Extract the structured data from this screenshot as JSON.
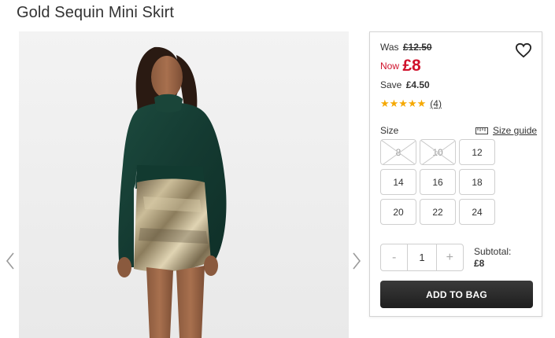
{
  "product": {
    "title": "Gold Sequin Mini Skirt"
  },
  "pricing": {
    "was_label": "Was",
    "was_price": "£12.50",
    "now_label": "Now",
    "now_price": "£8",
    "save_label": "Save",
    "save_amount": "£4.50",
    "now_color": "#d0112b"
  },
  "rating": {
    "stars": "★★★★★",
    "value": 5,
    "max": 5,
    "count": "(4)",
    "star_color": "#f5a800"
  },
  "size": {
    "label": "Size",
    "guide_label": "Size guide",
    "options": [
      {
        "label": "8",
        "available": false
      },
      {
        "label": "10",
        "available": false
      },
      {
        "label": "12",
        "available": true
      },
      {
        "label": "14",
        "available": true
      },
      {
        "label": "16",
        "available": true
      },
      {
        "label": "18",
        "available": true
      },
      {
        "label": "20",
        "available": true
      },
      {
        "label": "22",
        "available": true
      },
      {
        "label": "24",
        "available": true
      }
    ]
  },
  "quantity": {
    "minus": "-",
    "value": "1",
    "plus": "+"
  },
  "subtotal": {
    "label": "Subtotal:",
    "value": "£8"
  },
  "add_to_bag": {
    "label": "ADD TO BAG"
  },
  "icons": {
    "prev": "chevron-left-icon",
    "next": "chevron-right-icon",
    "wishlist": "heart-icon",
    "size_guide": "ruler-icon"
  }
}
